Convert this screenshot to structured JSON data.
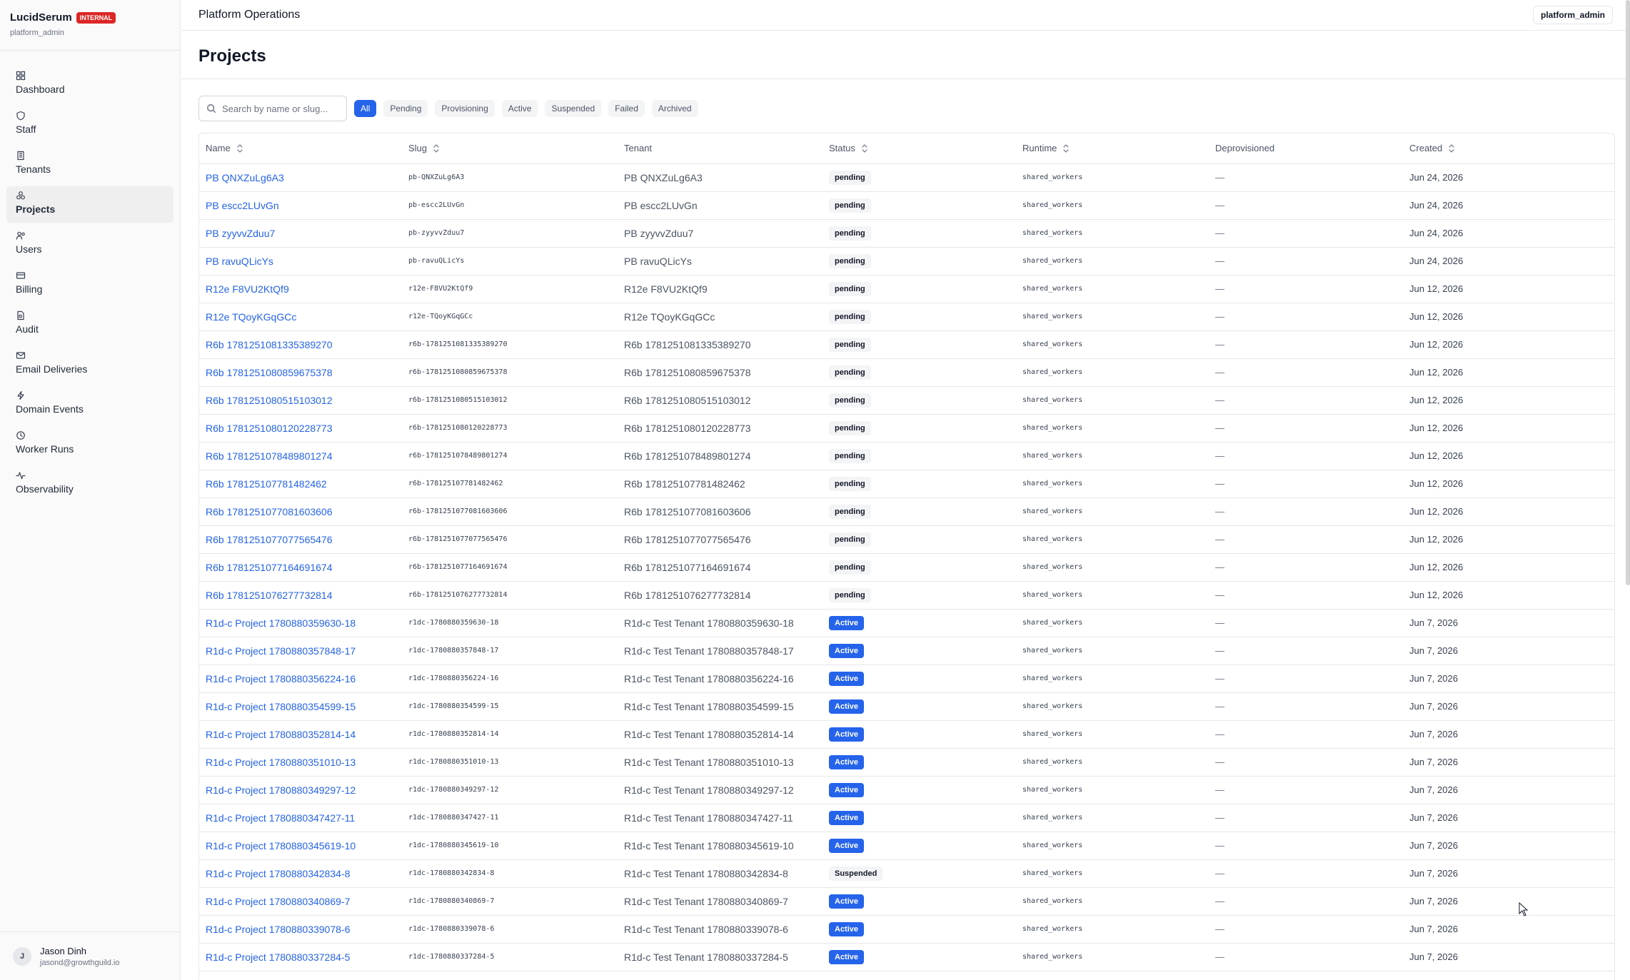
{
  "brand": {
    "name": "LucidSerum",
    "badge": "INTERNAL",
    "role": "platform_admin"
  },
  "nav": [
    {
      "label": "Dashboard",
      "icon": "dashboard-icon"
    },
    {
      "label": "Staff",
      "icon": "shield-icon"
    },
    {
      "label": "Tenants",
      "icon": "building-icon"
    },
    {
      "label": "Projects",
      "icon": "projects-icon",
      "active": true
    },
    {
      "label": "Users",
      "icon": "users-icon"
    },
    {
      "label": "Billing",
      "icon": "card-icon"
    },
    {
      "label": "Audit",
      "icon": "file-audit-icon"
    },
    {
      "label": "Email Deliveries",
      "icon": "mail-icon"
    },
    {
      "label": "Domain Events",
      "icon": "bolt-icon"
    },
    {
      "label": "Worker Runs",
      "icon": "clock-icon"
    },
    {
      "label": "Observability",
      "icon": "activity-icon"
    }
  ],
  "user": {
    "initial": "J",
    "name": "Jason Dinh",
    "email": "jasond@growthguild.io"
  },
  "topbar": {
    "title": "Platform Operations",
    "role": "platform_admin"
  },
  "page": {
    "title": "Projects"
  },
  "search": {
    "placeholder": "Search by name or slug..."
  },
  "filters": [
    "All",
    "Pending",
    "Provisioning",
    "Active",
    "Suspended",
    "Failed",
    "Archived"
  ],
  "active_filter": "All",
  "table": {
    "columns": [
      {
        "label": "Name",
        "sortable": true
      },
      {
        "label": "Slug",
        "sortable": true
      },
      {
        "label": "Tenant",
        "sortable": false
      },
      {
        "label": "Status",
        "sortable": true
      },
      {
        "label": "Runtime",
        "sortable": true
      },
      {
        "label": "Deprovisioned",
        "sortable": false
      },
      {
        "label": "Created",
        "sortable": true
      }
    ],
    "rows": [
      {
        "name": "PB QNXZuLg6A3",
        "slug": "pb-QNXZuLg6A3",
        "tenant": "PB QNXZuLg6A3",
        "status": "pending",
        "runtime": "shared_workers",
        "deprovisioned": "—",
        "created": "Jun 24, 2026"
      },
      {
        "name": "PB escc2LUvGn",
        "slug": "pb-escc2LUvGn",
        "tenant": "PB escc2LUvGn",
        "status": "pending",
        "runtime": "shared_workers",
        "deprovisioned": "—",
        "created": "Jun 24, 2026"
      },
      {
        "name": "PB zyyvvZduu7",
        "slug": "pb-zyyvvZduu7",
        "tenant": "PB zyyvvZduu7",
        "status": "pending",
        "runtime": "shared_workers",
        "deprovisioned": "—",
        "created": "Jun 24, 2026"
      },
      {
        "name": "PB ravuQLicYs",
        "slug": "pb-ravuQLicYs",
        "tenant": "PB ravuQLicYs",
        "status": "pending",
        "runtime": "shared_workers",
        "deprovisioned": "—",
        "created": "Jun 24, 2026"
      },
      {
        "name": "R12e F8VU2KtQf9",
        "slug": "r12e-F8VU2KtQf9",
        "tenant": "R12e F8VU2KtQf9",
        "status": "pending",
        "runtime": "shared_workers",
        "deprovisioned": "—",
        "created": "Jun 12, 2026"
      },
      {
        "name": "R12e TQoyKGqGCc",
        "slug": "r12e-TQoyKGqGCc",
        "tenant": "R12e TQoyKGqGCc",
        "status": "pending",
        "runtime": "shared_workers",
        "deprovisioned": "—",
        "created": "Jun 12, 2026"
      },
      {
        "name": "R6b 1781251081335389270",
        "slug": "r6b-1781251081335389270",
        "tenant": "R6b 1781251081335389270",
        "status": "pending",
        "runtime": "shared_workers",
        "deprovisioned": "—",
        "created": "Jun 12, 2026"
      },
      {
        "name": "R6b 1781251080859675378",
        "slug": "r6b-1781251080859675378",
        "tenant": "R6b 1781251080859675378",
        "status": "pending",
        "runtime": "shared_workers",
        "deprovisioned": "—",
        "created": "Jun 12, 2026"
      },
      {
        "name": "R6b 1781251080515103012",
        "slug": "r6b-1781251080515103012",
        "tenant": "R6b 1781251080515103012",
        "status": "pending",
        "runtime": "shared_workers",
        "deprovisioned": "—",
        "created": "Jun 12, 2026"
      },
      {
        "name": "R6b 1781251080120228773",
        "slug": "r6b-1781251080120228773",
        "tenant": "R6b 1781251080120228773",
        "status": "pending",
        "runtime": "shared_workers",
        "deprovisioned": "—",
        "created": "Jun 12, 2026"
      },
      {
        "name": "R6b 1781251078489801274",
        "slug": "r6b-1781251078489801274",
        "tenant": "R6b 1781251078489801274",
        "status": "pending",
        "runtime": "shared_workers",
        "deprovisioned": "—",
        "created": "Jun 12, 2026"
      },
      {
        "name": "R6b 178125107781482462",
        "slug": "r6b-178125107781482462",
        "tenant": "R6b 178125107781482462",
        "status": "pending",
        "runtime": "shared_workers",
        "deprovisioned": "—",
        "created": "Jun 12, 2026"
      },
      {
        "name": "R6b 1781251077081603606",
        "slug": "r6b-1781251077081603606",
        "tenant": "R6b 1781251077081603606",
        "status": "pending",
        "runtime": "shared_workers",
        "deprovisioned": "—",
        "created": "Jun 12, 2026"
      },
      {
        "name": "R6b 1781251077077565476",
        "slug": "r6b-1781251077077565476",
        "tenant": "R6b 1781251077077565476",
        "status": "pending",
        "runtime": "shared_workers",
        "deprovisioned": "—",
        "created": "Jun 12, 2026"
      },
      {
        "name": "R6b 1781251077164691674",
        "slug": "r6b-1781251077164691674",
        "tenant": "R6b 1781251077164691674",
        "status": "pending",
        "runtime": "shared_workers",
        "deprovisioned": "—",
        "created": "Jun 12, 2026"
      },
      {
        "name": "R6b 1781251076277732814",
        "slug": "r6b-1781251076277732814",
        "tenant": "R6b 1781251076277732814",
        "status": "pending",
        "runtime": "shared_workers",
        "deprovisioned": "—",
        "created": "Jun 12, 2026"
      },
      {
        "name": "R1d-c Project 1780880359630-18",
        "slug": "r1dc-1780880359630-18",
        "tenant": "R1d-c Test Tenant 1780880359630-18",
        "status": "Active",
        "runtime": "shared_workers",
        "deprovisioned": "—",
        "created": "Jun 7, 2026"
      },
      {
        "name": "R1d-c Project 1780880357848-17",
        "slug": "r1dc-1780880357848-17",
        "tenant": "R1d-c Test Tenant 1780880357848-17",
        "status": "Active",
        "runtime": "shared_workers",
        "deprovisioned": "—",
        "created": "Jun 7, 2026"
      },
      {
        "name": "R1d-c Project 1780880356224-16",
        "slug": "r1dc-1780880356224-16",
        "tenant": "R1d-c Test Tenant 1780880356224-16",
        "status": "Active",
        "runtime": "shared_workers",
        "deprovisioned": "—",
        "created": "Jun 7, 2026"
      },
      {
        "name": "R1d-c Project 1780880354599-15",
        "slug": "r1dc-1780880354599-15",
        "tenant": "R1d-c Test Tenant 1780880354599-15",
        "status": "Active",
        "runtime": "shared_workers",
        "deprovisioned": "—",
        "created": "Jun 7, 2026"
      },
      {
        "name": "R1d-c Project 1780880352814-14",
        "slug": "r1dc-1780880352814-14",
        "tenant": "R1d-c Test Tenant 1780880352814-14",
        "status": "Active",
        "runtime": "shared_workers",
        "deprovisioned": "—",
        "created": "Jun 7, 2026"
      },
      {
        "name": "R1d-c Project 1780880351010-13",
        "slug": "r1dc-1780880351010-13",
        "tenant": "R1d-c Test Tenant 1780880351010-13",
        "status": "Active",
        "runtime": "shared_workers",
        "deprovisioned": "—",
        "created": "Jun 7, 2026"
      },
      {
        "name": "R1d-c Project 1780880349297-12",
        "slug": "r1dc-1780880349297-12",
        "tenant": "R1d-c Test Tenant 1780880349297-12",
        "status": "Active",
        "runtime": "shared_workers",
        "deprovisioned": "—",
        "created": "Jun 7, 2026"
      },
      {
        "name": "R1d-c Project 1780880347427-11",
        "slug": "r1dc-1780880347427-11",
        "tenant": "R1d-c Test Tenant 1780880347427-11",
        "status": "Active",
        "runtime": "shared_workers",
        "deprovisioned": "—",
        "created": "Jun 7, 2026"
      },
      {
        "name": "R1d-c Project 1780880345619-10",
        "slug": "r1dc-1780880345619-10",
        "tenant": "R1d-c Test Tenant 1780880345619-10",
        "status": "Active",
        "runtime": "shared_workers",
        "deprovisioned": "—",
        "created": "Jun 7, 2026"
      },
      {
        "name": "R1d-c Project 1780880342834-8",
        "slug": "r1dc-1780880342834-8",
        "tenant": "R1d-c Test Tenant 1780880342834-8",
        "status": "Suspended",
        "runtime": "shared_workers",
        "deprovisioned": "—",
        "created": "Jun 7, 2026"
      },
      {
        "name": "R1d-c Project 1780880340869-7",
        "slug": "r1dc-1780880340869-7",
        "tenant": "R1d-c Test Tenant 1780880340869-7",
        "status": "Active",
        "runtime": "shared_workers",
        "deprovisioned": "—",
        "created": "Jun 7, 2026"
      },
      {
        "name": "R1d-c Project 1780880339078-6",
        "slug": "r1dc-1780880339078-6",
        "tenant": "R1d-c Test Tenant 1780880339078-6",
        "status": "Active",
        "runtime": "shared_workers",
        "deprovisioned": "—",
        "created": "Jun 7, 2026"
      },
      {
        "name": "R1d-c Project 1780880337284-5",
        "slug": "r1dc-1780880337284-5",
        "tenant": "R1d-c Test Tenant 1780880337284-5",
        "status": "Active",
        "runtime": "shared_workers",
        "deprovisioned": "—",
        "created": "Jun 7, 2026"
      }
    ]
  },
  "colors": {
    "accent": "#2563eb",
    "badge_red": "#dc2626",
    "border": "#e5e7eb",
    "muted": "#6b7280"
  }
}
